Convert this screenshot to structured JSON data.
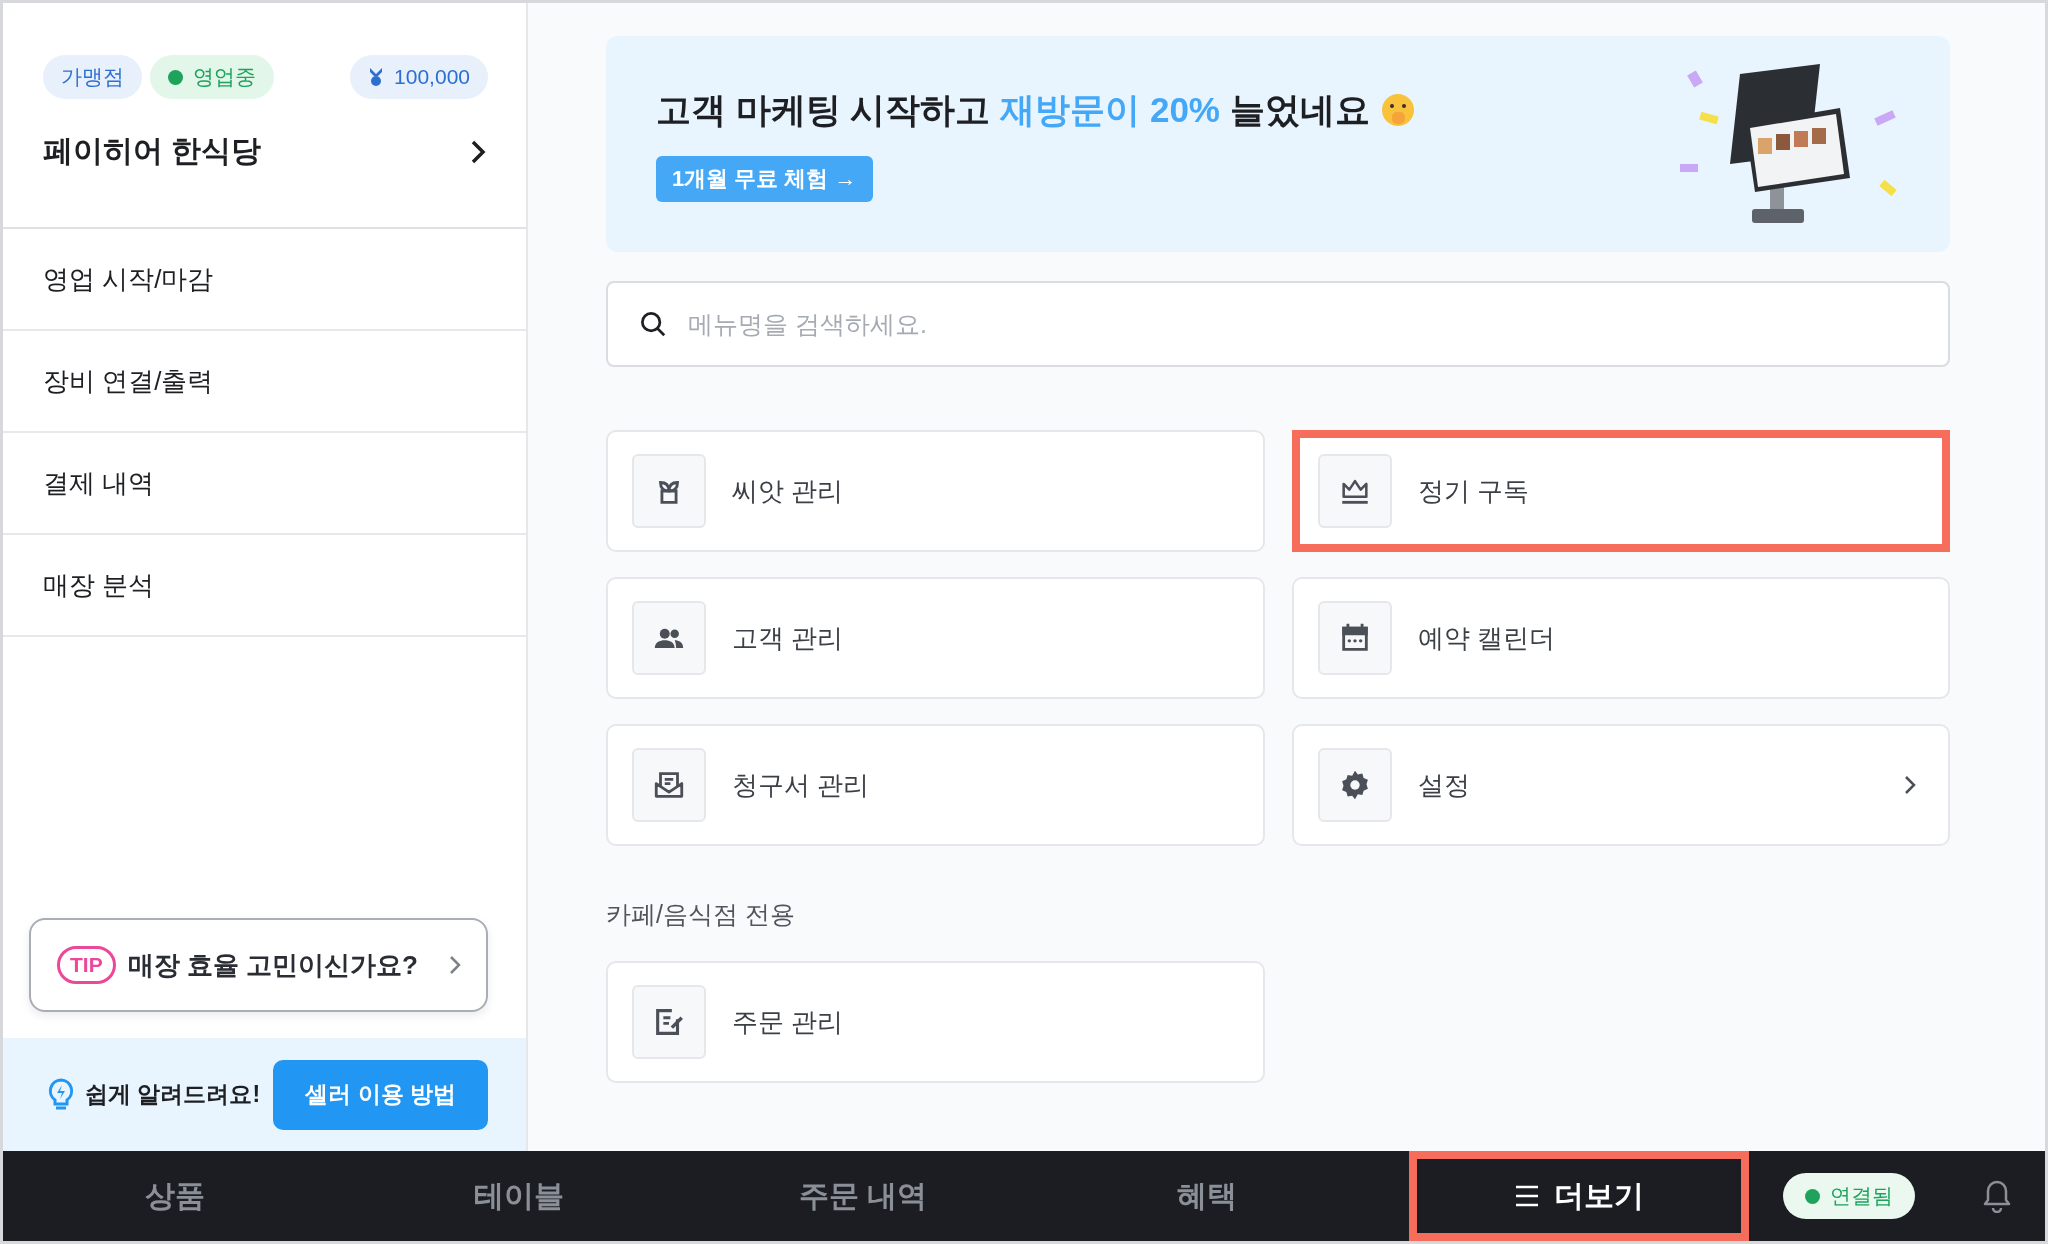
{
  "sidebar": {
    "badges": [
      {
        "kind": "type",
        "text": "가맹점"
      },
      {
        "kind": "status",
        "text": "영업중"
      }
    ],
    "points": "100,000",
    "store_name": "페이히어 한식당",
    "menu": [
      {
        "label": "영업 시작/마감"
      },
      {
        "label": "장비 연결/출력"
      },
      {
        "label": "결제 내역"
      },
      {
        "label": "매장 분석"
      }
    ],
    "tip": {
      "badge": "TIP",
      "text": "매장 효율 고민이신가요?"
    },
    "help": {
      "text": "쉽게 알려드려요!",
      "button": "셀러 이용 방법"
    }
  },
  "banner": {
    "headline_before": "고객 마케팅 시작하고 ",
    "headline_highlight": "재방문이 20%",
    "headline_after": " 늘었네요",
    "button": "1개월 무료 체험 →"
  },
  "search": {
    "placeholder": "메뉴명을 검색하세요."
  },
  "tiles": [
    {
      "kind": "sprout",
      "label": "씨앗 관리",
      "highlighted": false,
      "chevron": false
    },
    {
      "kind": "crown",
      "label": "정기 구독",
      "highlighted": true,
      "chevron": false
    },
    {
      "kind": "people",
      "label": "고객 관리",
      "highlighted": false,
      "chevron": false
    },
    {
      "kind": "calendar",
      "label": "예약 캘린더",
      "highlighted": false,
      "chevron": false
    },
    {
      "kind": "mail",
      "label": "청구서 관리",
      "highlighted": false,
      "chevron": false
    },
    {
      "kind": "gear",
      "label": "설정",
      "highlighted": false,
      "chevron": true
    }
  ],
  "section": {
    "title": "카페/음식점 전용",
    "tiles": [
      {
        "kind": "edit",
        "label": "주문 관리",
        "highlighted": false,
        "chevron": false
      }
    ]
  },
  "bottom_nav": {
    "tabs": [
      {
        "label": "상품",
        "selected": false,
        "highlighted": false,
        "menu_icon": false
      },
      {
        "label": "테이블",
        "selected": false,
        "highlighted": false,
        "menu_icon": false
      },
      {
        "label": "주문 내역",
        "selected": false,
        "highlighted": false,
        "menu_icon": false
      },
      {
        "label": "혜택",
        "selected": false,
        "highlighted": false,
        "menu_icon": false
      },
      {
        "label": "더보기",
        "selected": true,
        "highlighted": true,
        "menu_icon": true
      }
    ],
    "connection": "연결됨"
  }
}
